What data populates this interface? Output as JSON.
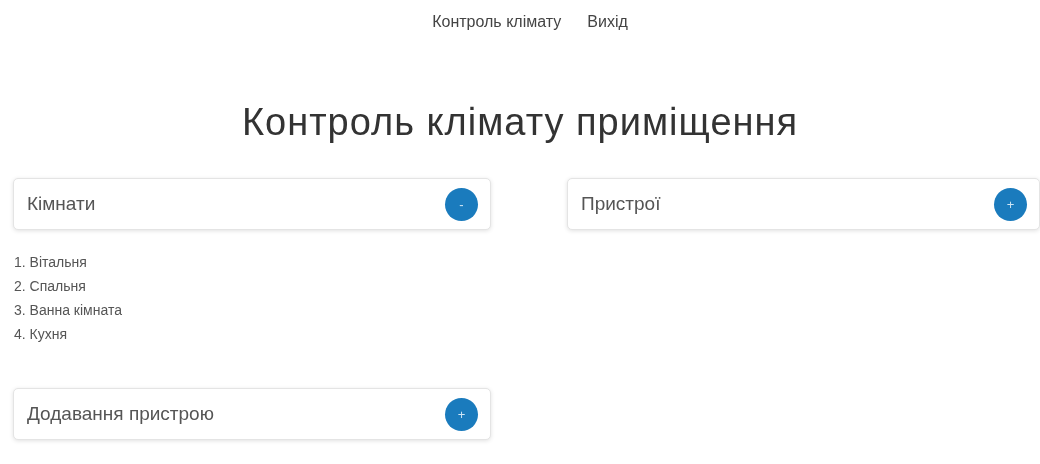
{
  "nav": [
    {
      "label": "Контроль клімату"
    },
    {
      "label": "Вихід"
    }
  ],
  "title": "Контроль клімату приміщення",
  "columns": [
    {
      "panels": [
        {
          "title": "Кімнати",
          "toggle": "-",
          "items": [
            "1. Вітальня",
            "2. Спальня",
            "3. Ванна кімната",
            "4. Кухня"
          ]
        },
        {
          "title": "Додавання пристрою",
          "toggle": "+"
        }
      ]
    },
    {
      "panels": [
        {
          "title": "Пристрої",
          "toggle": "+"
        }
      ]
    }
  ]
}
